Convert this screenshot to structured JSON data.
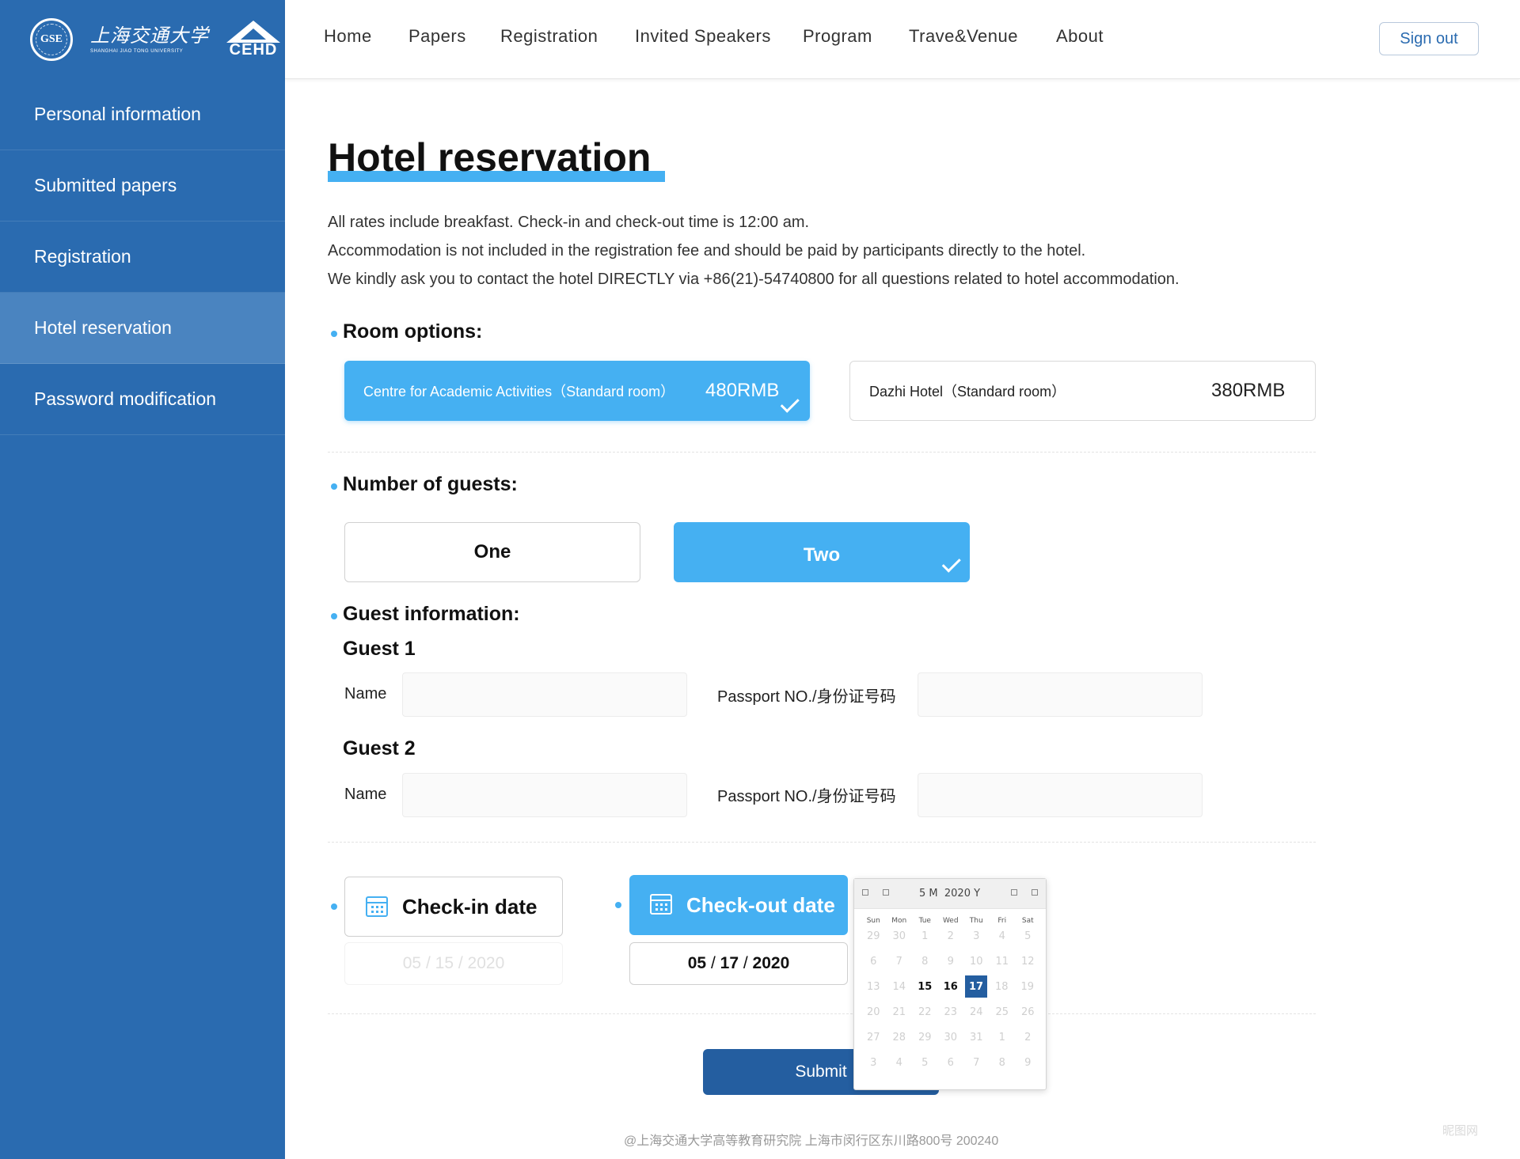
{
  "sidebar": {
    "logo": {
      "seal_text": "GSE",
      "university_cn": "上海交通大学",
      "university_en": "SHANGHAI JIAO TONG UNIVERSITY",
      "cehd": "CEHD"
    },
    "items": [
      {
        "label": "Personal information"
      },
      {
        "label": "Submitted papers"
      },
      {
        "label": "Registration"
      },
      {
        "label": "Hotel reservation",
        "active": true
      },
      {
        "label": "Password modification"
      }
    ]
  },
  "nav": {
    "items": [
      "Home",
      "Papers",
      "Registration",
      "Invited Speakers",
      "Program",
      "Trave&Venue",
      "About"
    ],
    "sign_out": "Sign out"
  },
  "page": {
    "title": "Hotel reservation",
    "intro": [
      "All rates include breakfast. Check-in and check-out time is 12:00 am.",
      "Accommodation is not included in the registration fee and should be paid by participants directly to the hotel.",
      "We kindly ask you to contact the hotel DIRECTLY via +86(21)-54740800 for all questions related to hotel accommodation."
    ],
    "room_options": {
      "label": "Room options:",
      "options": [
        {
          "name": "Centre for Academic Activities（Standard room）",
          "price": "480RMB",
          "selected": true
        },
        {
          "name": "Dazhi Hotel（Standard room）",
          "price": "380RMB",
          "selected": false
        }
      ]
    },
    "guests": {
      "label": "Number of guests:",
      "options": [
        {
          "label": "One",
          "selected": false
        },
        {
          "label": "Two",
          "selected": true
        }
      ]
    },
    "guest_info": {
      "label": "Guest information:",
      "guests": [
        {
          "title": "Guest 1",
          "name_label": "Name",
          "passport_label": "Passport NO./身份证号码",
          "name_value": "",
          "passport_value": ""
        },
        {
          "title": "Guest 2",
          "name_label": "Name",
          "passport_label": "Passport NO./身份证号码",
          "name_value": "",
          "passport_value": ""
        }
      ]
    },
    "checkin": {
      "label": "Check-in date",
      "value_mm": "05",
      "value_dd": "15",
      "value_yyyy": "2020",
      "sep": "/"
    },
    "checkout": {
      "label": "Check-out date",
      "value_mm": "05",
      "value_dd": "17",
      "value_yyyy": "2020",
      "sep": "/"
    },
    "submit": "Submit"
  },
  "calendar": {
    "month_label": "5 M",
    "year_label": "2020 Y",
    "dow": [
      "Sun",
      "Mon",
      "Tue",
      "Wed",
      "Thu",
      "Fri",
      "Sat"
    ],
    "weeks": [
      [
        "29",
        "30",
        "1",
        "2",
        "3",
        "4",
        "5"
      ],
      [
        "6",
        "7",
        "8",
        "9",
        "10",
        "11",
        "12"
      ],
      [
        "13",
        "14",
        "15",
        "16",
        "17",
        "18",
        "19"
      ],
      [
        "20",
        "21",
        "22",
        "23",
        "24",
        "25",
        "26"
      ],
      [
        "27",
        "28",
        "29",
        "30",
        "31",
        "1",
        "2"
      ],
      [
        "3",
        "4",
        "5",
        "6",
        "7",
        "8",
        "9"
      ]
    ],
    "highlighted": [
      "15",
      "16"
    ],
    "selected": "17"
  },
  "footer": "@上海交通大学高等教育研究院   上海市闵行区东川路800号   200240",
  "watermark": "昵图网",
  "colors": {
    "sidebar": "#2a6bb0",
    "accent": "#45b0f2",
    "primary": "#245ea0"
  }
}
